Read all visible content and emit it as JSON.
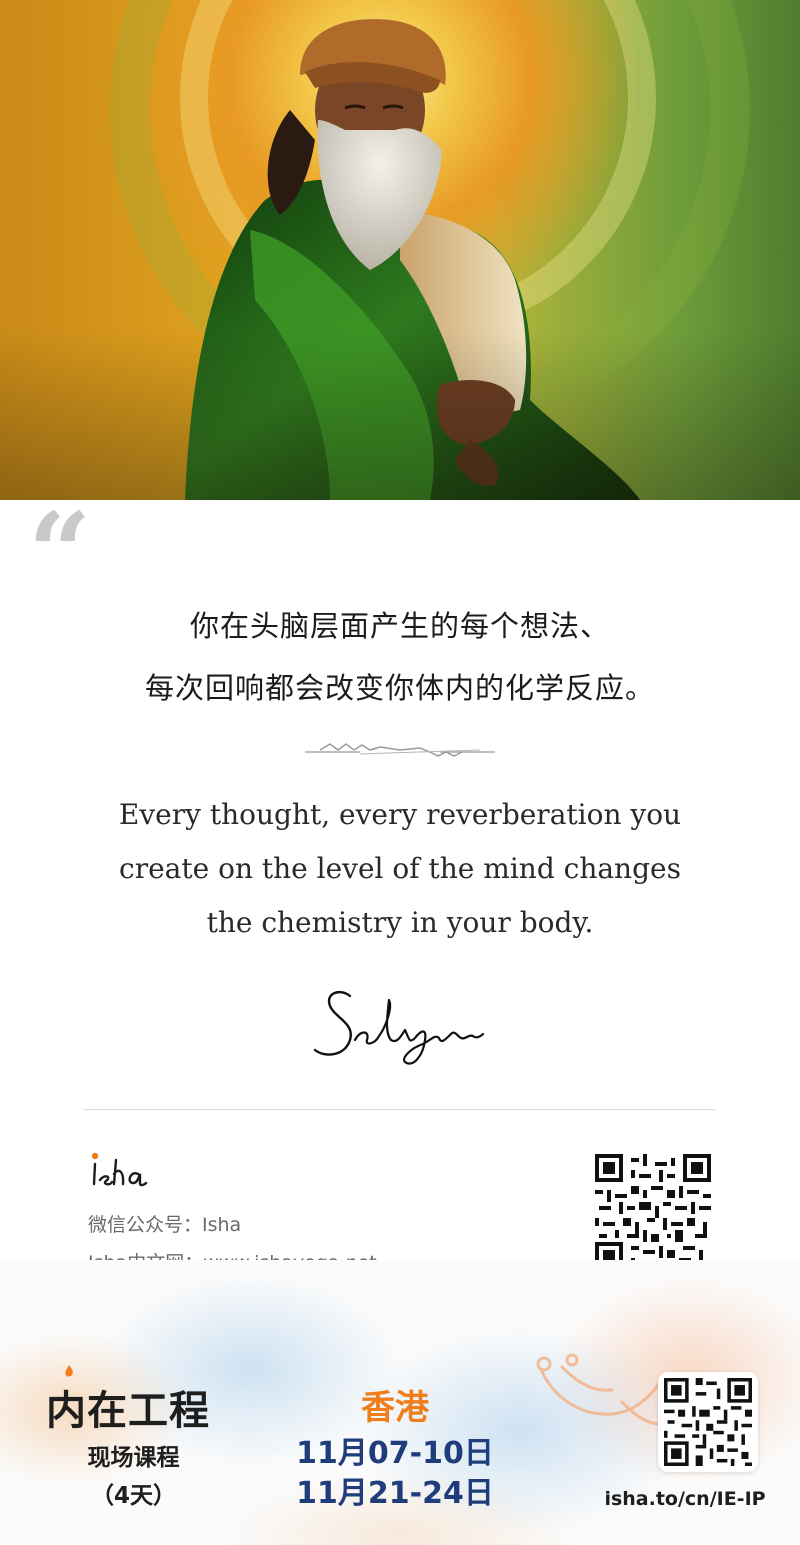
{
  "quote": {
    "zh_line1": "你在头脑层面产生的每个想法、",
    "zh_line2": "每次回响都会改变你体内的化学反应。",
    "en_line1": "Every thought, every reverberation you",
    "en_line2": "create on the level of the mind changes",
    "en_line3": "the chemistry in your body.",
    "mark": "“",
    "signature": "Sadhguru"
  },
  "info": {
    "logo_text": "isha",
    "wechat": "微信公众号：Isha",
    "website": "Isha中文网：www.ishayoga.net"
  },
  "event": {
    "title": "内在工程",
    "subtitle": "现场课程",
    "duration": "（4天）",
    "city": "香港",
    "dates": [
      "11月07-10日",
      "11月21-24日"
    ],
    "link": "isha.to/cn/IE-IP"
  },
  "colors": {
    "city": "#f07c1a",
    "dates": "#1f3d7a",
    "robe": "#2f7a1e",
    "turban": "#b06a2a"
  }
}
